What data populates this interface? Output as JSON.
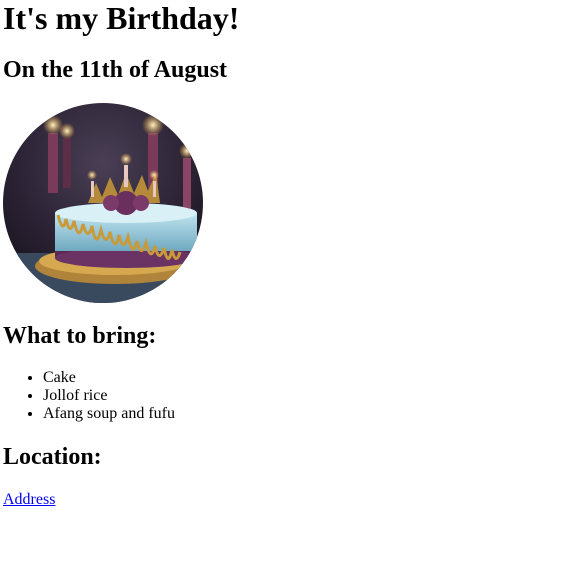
{
  "heading": "It's my Birthday!",
  "subheading": "On the 11th of August",
  "image": {
    "icon": "birthday-cake-image"
  },
  "bring": {
    "title": "What to bring:",
    "items": [
      "Cake",
      "Jollof rice",
      "Afang soup and fufu"
    ]
  },
  "location": {
    "title": "Location:",
    "link_label": "Address"
  },
  "colors": {
    "link": "#0000ee",
    "text": "#000000",
    "background": "#ffffff"
  }
}
